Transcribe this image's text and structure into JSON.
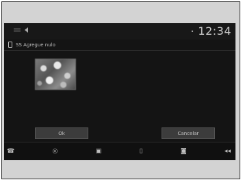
{
  "status": {
    "left_small_text": "",
    "dot": "•",
    "time": "12:34"
  },
  "title": {
    "text": "SS Agregue nulo"
  },
  "buttons": {
    "ok_label": "Ok",
    "cancel_label": "Cancelar"
  },
  "bottom_bar": {
    "items": [
      {
        "icon": "☎",
        "label": ""
      },
      {
        "icon": "◎",
        "label": ""
      },
      {
        "icon": "▣",
        "label": ""
      },
      {
        "icon": "▯",
        "label": ""
      },
      {
        "icon": "◙",
        "label": ""
      },
      {
        "icon": "◂◂",
        "label": ""
      }
    ]
  },
  "colors": {
    "screen_bg": "#141414",
    "button_bg": "#3c3c3c",
    "frame_bg": "#d3d3d3"
  }
}
